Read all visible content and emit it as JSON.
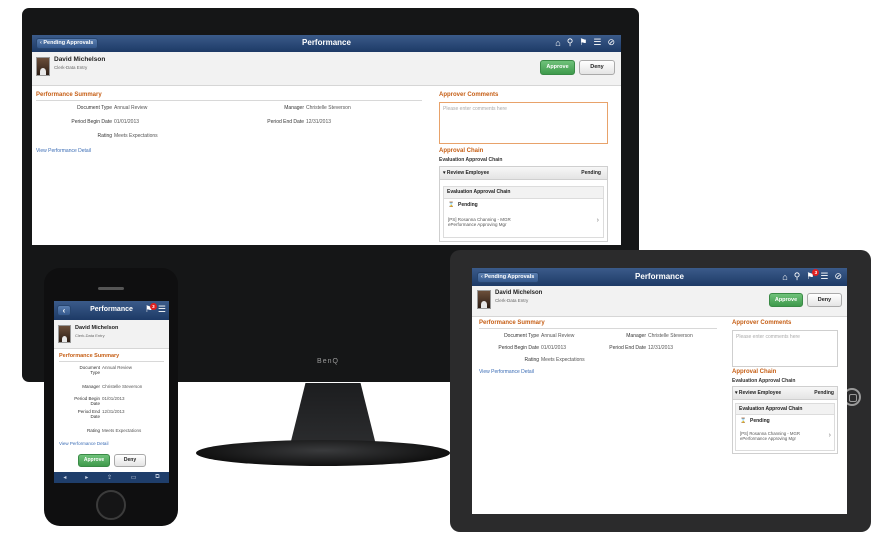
{
  "app": {
    "title": "Performance",
    "back_label": "Pending Approvals",
    "back_glyph": "‹",
    "notification_count": "3"
  },
  "icons": {
    "home": "⌂",
    "search": "⚲",
    "flag": "⚑",
    "menu": "☰",
    "compass": "⊘"
  },
  "user": {
    "name": "David Michelson",
    "role": "Clerk-Data Entry"
  },
  "actions": {
    "approve": "Approve",
    "deny": "Deny"
  },
  "summary": {
    "title": "Performance Summary",
    "document_type_label": "Document Type",
    "document_type_value": "Annual Review",
    "manager_label": "Manager",
    "manager_value": "Christelle Steverson",
    "period_begin_label": "Period Begin Date",
    "period_begin_value": "01/01/2013",
    "period_end_label": "Period End Date",
    "period_end_value": "12/31/2013",
    "rating_label": "Rating",
    "rating_value": "Meets Expectations",
    "link": "View Performance Detail"
  },
  "comments": {
    "title": "Approver Comments",
    "placeholder": "Please enter comments here"
  },
  "chain": {
    "title": "Approval Chain",
    "subtitle": "Evaluation Approval Chain",
    "step_label": "Review Employee",
    "step_status": "Pending",
    "inner_title": "Evaluation Approval Chain",
    "inner_status": "Pending",
    "approver_line1": "[PS] Rosanna Channing - MGR",
    "approver_line2": "ePerformance Approving Mgr"
  },
  "phone_labels": {
    "document_label": "Document",
    "document_label2": "Type",
    "period_begin_label1": "Period Begin",
    "period_begin_label2": "Date",
    "period_end_label1": "Period End",
    "period_end_label2": "Date"
  },
  "device": {
    "monitor_brand": "BenQ"
  },
  "colors": {
    "header": "#1d3a66",
    "accent": "#c65f16",
    "approve": "#3f9a4c",
    "link": "#3a6cb5"
  }
}
